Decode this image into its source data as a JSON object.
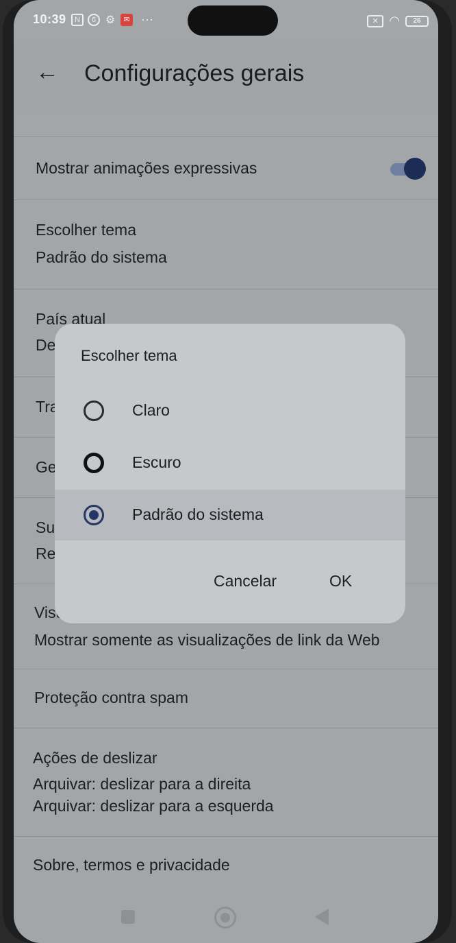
{
  "status_bar": {
    "time": "10:39",
    "battery": "26"
  },
  "header": {
    "title": "Configurações gerais"
  },
  "settings": {
    "expressive_animations": "Mostrar animações expressivas",
    "theme": {
      "label": "Escolher tema",
      "value": "Padrão do sistema"
    },
    "country": {
      "label": "País atual",
      "value_partial": "De"
    },
    "partial_row_1": "Tra",
    "partial_row_2": "Ge",
    "partial_row_3": {
      "label": "Su",
      "value": "Re"
    },
    "link_previews": {
      "label_partial": "Visu",
      "value": "Mostrar somente as visualizações de link da Web"
    },
    "spam": "Proteção contra spam",
    "swipe": {
      "label": "Ações de deslizar",
      "right": "Arquivar: deslizar para a direita",
      "left": "Arquivar: deslizar para a esquerda"
    },
    "about": "Sobre, termos e privacidade"
  },
  "dialog": {
    "title": "Escolher tema",
    "options": [
      "Claro",
      "Escuro",
      "Padrão do sistema"
    ],
    "selected": "Padrão do sistema",
    "cancel": "Cancelar",
    "ok": "OK"
  },
  "colors": {
    "accent": "#243663",
    "scrim": "#a3a6a9"
  }
}
